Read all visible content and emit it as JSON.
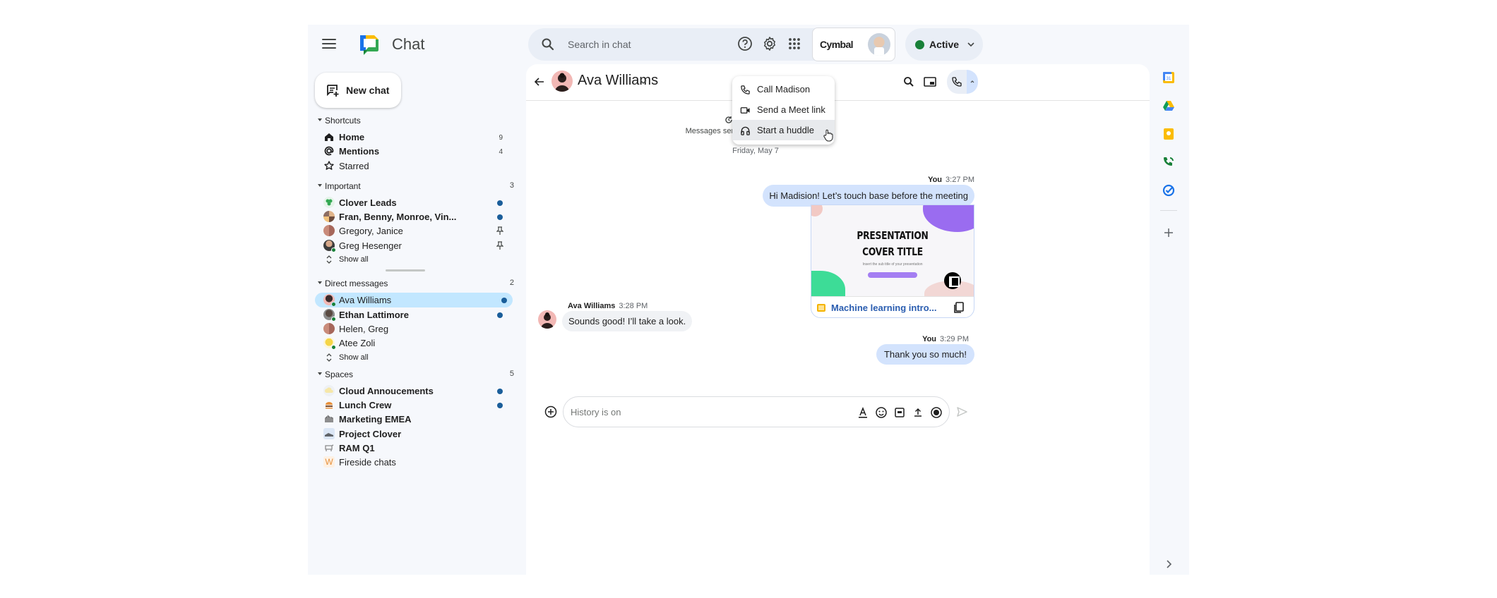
{
  "app": {
    "title": "Chat",
    "search_placeholder": "Search in chat",
    "status": {
      "label": "Active",
      "color": "#188038"
    },
    "account_brand": "Cymbal"
  },
  "icons": {
    "menu": "hamburger-menu-icon",
    "help": "help-circle-icon",
    "settings": "gear-icon",
    "apps": "apps-grid-icon"
  },
  "sidebar": {
    "new_chat_label": "New chat",
    "sections": [
      {
        "label": "Shortcuts",
        "count": "",
        "items": [
          {
            "label": "Home",
            "badge": "9",
            "bold": true,
            "icon": "home-icon"
          },
          {
            "label": "Mentions",
            "badge": "4",
            "bold": true,
            "icon": "at-sign-icon"
          },
          {
            "label": "Starred",
            "badge": "",
            "bold": false,
            "icon": "star-icon"
          }
        ]
      },
      {
        "label": "Important",
        "count": "3",
        "items": [
          {
            "label": "Clover Leads",
            "unread": true,
            "bold": true
          },
          {
            "label": "Fran, Benny, Monroe, Vin...",
            "unread": true,
            "bold": true
          },
          {
            "label": "Gregory, Janice",
            "pinned": true,
            "bold": false
          },
          {
            "label": "Greg Hesenger",
            "pinned": true,
            "bold": false,
            "online": true
          },
          {
            "label": "Show all",
            "show_all": true
          }
        ]
      },
      {
        "label": "Direct messages",
        "count": "2",
        "items": [
          {
            "label": "Ava Williams",
            "unread": true,
            "active": true,
            "online": true
          },
          {
            "label": "Ethan Lattimore",
            "unread": true,
            "bold": true,
            "online": true
          },
          {
            "label": "Helen, Greg",
            "bold": false
          },
          {
            "label": "Atee Zoli",
            "bold": false,
            "online": true
          },
          {
            "label": "Show all",
            "show_all": true
          }
        ]
      },
      {
        "label": "Spaces",
        "count": "5",
        "items": [
          {
            "label": "Cloud Annoucements",
            "unread": true,
            "bold": true
          },
          {
            "label": "Lunch Crew",
            "unread": true,
            "bold": true
          },
          {
            "label": "Marketing EMEA",
            "bold": true
          },
          {
            "label": "Project Clover",
            "bold": true
          },
          {
            "label": "RAM Q1",
            "bold": true
          },
          {
            "label": "Fireside chats",
            "bold": false,
            "letter": "W"
          }
        ]
      }
    ]
  },
  "chat": {
    "contact_name": "Ava Williams",
    "history_title": "History is on",
    "history_subtitle": "Messages sent with history on are saved",
    "date_separator": "Friday, May 7",
    "messages": [
      {
        "sender": "You",
        "time": "3:27 PM",
        "text": "Hi Madision! Let’s touch base before the meeting",
        "mine": true
      },
      {
        "sender": "Ava Williams",
        "time": "3:28 PM",
        "text": "Sounds good! I’ll take a look.",
        "mine": false
      },
      {
        "sender": "You",
        "time": "3:29 PM",
        "text": "Thank you so much!",
        "mine": true
      }
    ],
    "attachment": {
      "title_line1": "PRESENTATION",
      "title_line2": "COVER TITLE",
      "subtitle": "Insert the sub title of your presentation",
      "file_name": "Machine learning intro..."
    },
    "composer_placeholder": "History is on"
  },
  "call_menu": {
    "items": [
      {
        "label": "Call Madison",
        "icon": "phone-icon"
      },
      {
        "label": "Send a Meet link",
        "icon": "video-camera-icon"
      },
      {
        "label": "Start a huddle",
        "icon": "headphones-icon",
        "hovered": true
      }
    ]
  },
  "right_rail": {
    "apps": [
      "calendar-icon",
      "drive-icon",
      "keep-icon",
      "voice-icon",
      "tasks-icon"
    ]
  }
}
